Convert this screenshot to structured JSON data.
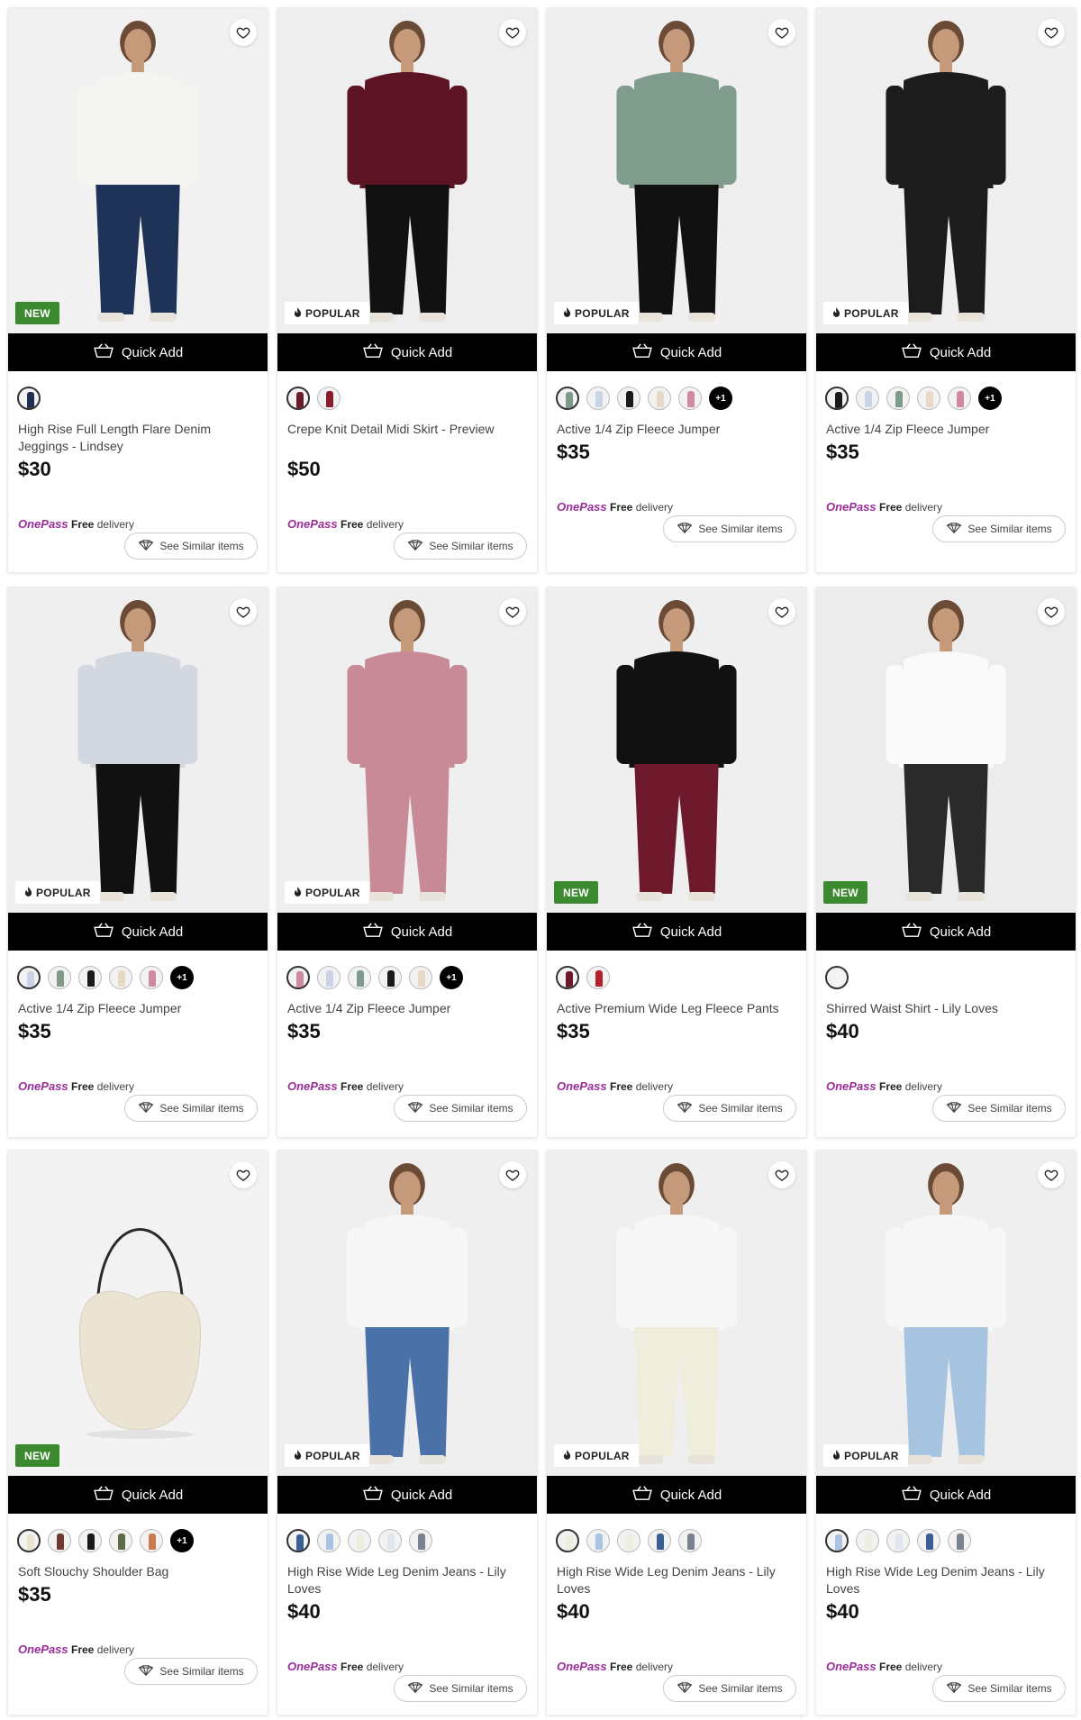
{
  "quick_add_label": "Quick Add",
  "similar_label": "See Similar items",
  "onepass": {
    "brand": "OnePass",
    "free": "Free",
    "delivery": "delivery"
  },
  "products": [
    {
      "name": "High Rise Full Length Flare Denim Jeggings - Lindsey",
      "price": "$30",
      "badge": "NEW",
      "badge_type": "new",
      "swatches": [
        "#1f2f52"
      ],
      "more": "",
      "top": "#f4f4f0",
      "bottom": "#1f3358",
      "bg": "#f1f1f1"
    },
    {
      "name": "Crepe Knit Detail Midi Skirt - Preview",
      "price": "$50",
      "badge": "POPULAR",
      "badge_type": "popular",
      "swatches": [
        "#6b1a2a",
        "#8b1c2c"
      ],
      "more": "",
      "top": "#5c1424",
      "bottom": "#111111",
      "bg": "#eeeeee"
    },
    {
      "name": "Active 1/4 Zip Fleece Jumper",
      "price": "$35",
      "badge": "POPULAR",
      "badge_type": "popular",
      "swatches": [
        "#7e9a8a",
        "#c9d4e4",
        "#1a1a1a",
        "#e8d8c6",
        "#d08aa0"
      ],
      "more": "+1",
      "top": "#7f9c8d",
      "bottom": "#111111",
      "bg": "#efefef"
    },
    {
      "name": "Active 1/4 Zip Fleece Jumper",
      "price": "$35",
      "badge": "POPULAR",
      "badge_type": "popular",
      "swatches": [
        "#1a1a1a",
        "#c9d4e4",
        "#7e9a8a",
        "#e8d8c6",
        "#d08aa0"
      ],
      "more": "+1",
      "top": "#1c1c1c",
      "bottom": "#1c1c1c",
      "bg": "#efefef"
    },
    {
      "name": "Active 1/4 Zip Fleece Jumper",
      "price": "$35",
      "badge": "POPULAR",
      "badge_type": "popular",
      "swatches": [
        "#c9d4e4",
        "#7e9a8a",
        "#1a1a1a",
        "#e8d8c6",
        "#d08aa0"
      ],
      "more": "+1",
      "top": "#d3d7e0",
      "bottom": "#111111",
      "bg": "#efefef"
    },
    {
      "name": "Active 1/4 Zip Fleece Jumper",
      "price": "$35",
      "badge": "POPULAR",
      "badge_type": "popular",
      "swatches": [
        "#d08aa0",
        "#c9d4e4",
        "#7e9a8a",
        "#1a1a1a",
        "#e8d8c6"
      ],
      "more": "+1",
      "top": "#c98a98",
      "bottom": "#c98a98",
      "bg": "#efefef"
    },
    {
      "name": "Active Premium Wide Leg Fleece Pants",
      "price": "$35",
      "badge": "NEW",
      "badge_type": "new",
      "swatches": [
        "#6b1a2a",
        "#b3212f"
      ],
      "more": "",
      "top": "#111111",
      "bottom": "#6e1a2c",
      "bg": "#efefef"
    },
    {
      "name": "Shirred Waist Shirt - Lily Loves",
      "price": "$40",
      "badge": "NEW",
      "badge_type": "new",
      "swatches": [
        "#f4f4f4"
      ],
      "more": "",
      "top": "#fafafa",
      "bottom": "#2a2a2a",
      "bg": "#ececec"
    },
    {
      "name": "Soft Slouchy Shoulder Bag",
      "price": "$35",
      "badge": "NEW",
      "badge_type": "new",
      "swatches": [
        "#ebe3d2",
        "#6e3a2e",
        "#1a1a1a",
        "#5d6b45",
        "#c97a4f"
      ],
      "more": "+1",
      "top": "#ebe4d3",
      "bottom": "#ebe4d3",
      "bg": "#f3f3f3"
    },
    {
      "name": "High Rise Wide Leg Denim Jeans - Lily Loves",
      "price": "$40",
      "badge": "POPULAR",
      "badge_type": "popular",
      "swatches": [
        "#3b5f94",
        "#a9c4e0",
        "#eeeee0",
        "#dfe6ee",
        "#7a8290"
      ],
      "more": "",
      "top": "#f7f7f7",
      "bottom": "#4a72a8",
      "bg": "#efefef"
    },
    {
      "name": "High Rise Wide Leg Denim Jeans - Lily Loves",
      "price": "$40",
      "badge": "POPULAR",
      "badge_type": "popular",
      "swatches": [
        "#eeeee0",
        "#a9c4e0",
        "#eeeee0",
        "#3b5f94",
        "#7a8290"
      ],
      "more": "",
      "top": "#f7f7f7",
      "bottom": "#efeddc",
      "bg": "#efefef"
    },
    {
      "name": "High Rise Wide Leg Denim Jeans - Lily Loves",
      "price": "$40",
      "badge": "POPULAR",
      "badge_type": "popular",
      "swatches": [
        "#a9c4e0",
        "#eeeee0",
        "#dfe6ee",
        "#3b5f94",
        "#7a8290"
      ],
      "more": "",
      "top": "#f7f7f7",
      "bottom": "#a6c3e0",
      "bg": "#efefef"
    }
  ]
}
